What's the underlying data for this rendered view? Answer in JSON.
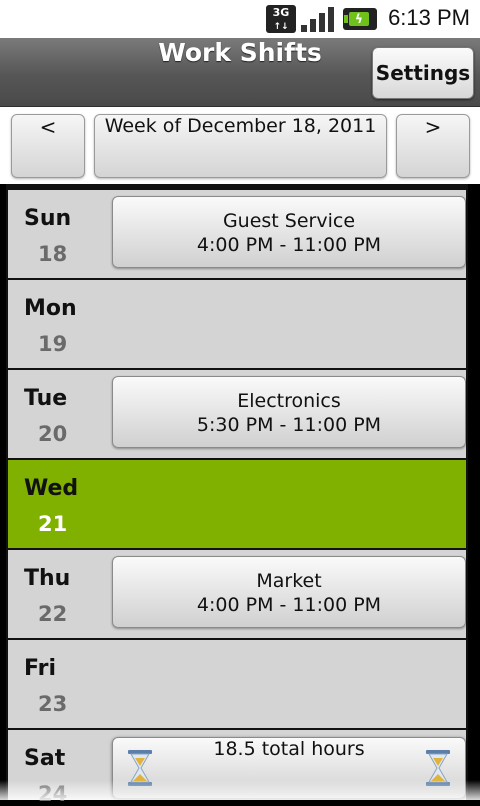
{
  "status_bar": {
    "network": "3G",
    "time": "6:13 PM"
  },
  "title_bar": {
    "title": "Work Shifts",
    "settings_label": "Settings"
  },
  "week_nav": {
    "prev_label": "<",
    "week_label": "Week of December 18, 2011",
    "next_label": ">"
  },
  "days": [
    {
      "name": "Sun",
      "date": "18",
      "shift": {
        "dept": "Guest Service",
        "time": "4:00 PM - 11:00 PM"
      }
    },
    {
      "name": "Mon",
      "date": "19"
    },
    {
      "name": "Tue",
      "date": "20",
      "shift": {
        "dept": "Electronics",
        "time": "5:30 PM - 11:00 PM"
      }
    },
    {
      "name": "Wed",
      "date": "21",
      "today": true
    },
    {
      "name": "Thu",
      "date": "22",
      "shift": {
        "dept": "Market",
        "time": "4:00 PM - 11:00 PM"
      }
    },
    {
      "name": "Fri",
      "date": "23"
    },
    {
      "name": "Sat",
      "date": "24"
    }
  ],
  "total": {
    "label": "18.5 total hours",
    "icon": "hourglass-icon"
  },
  "colors": {
    "today_highlight": "#80b000",
    "day_row": "#d4d4d4",
    "battery": "#6fc21a"
  }
}
